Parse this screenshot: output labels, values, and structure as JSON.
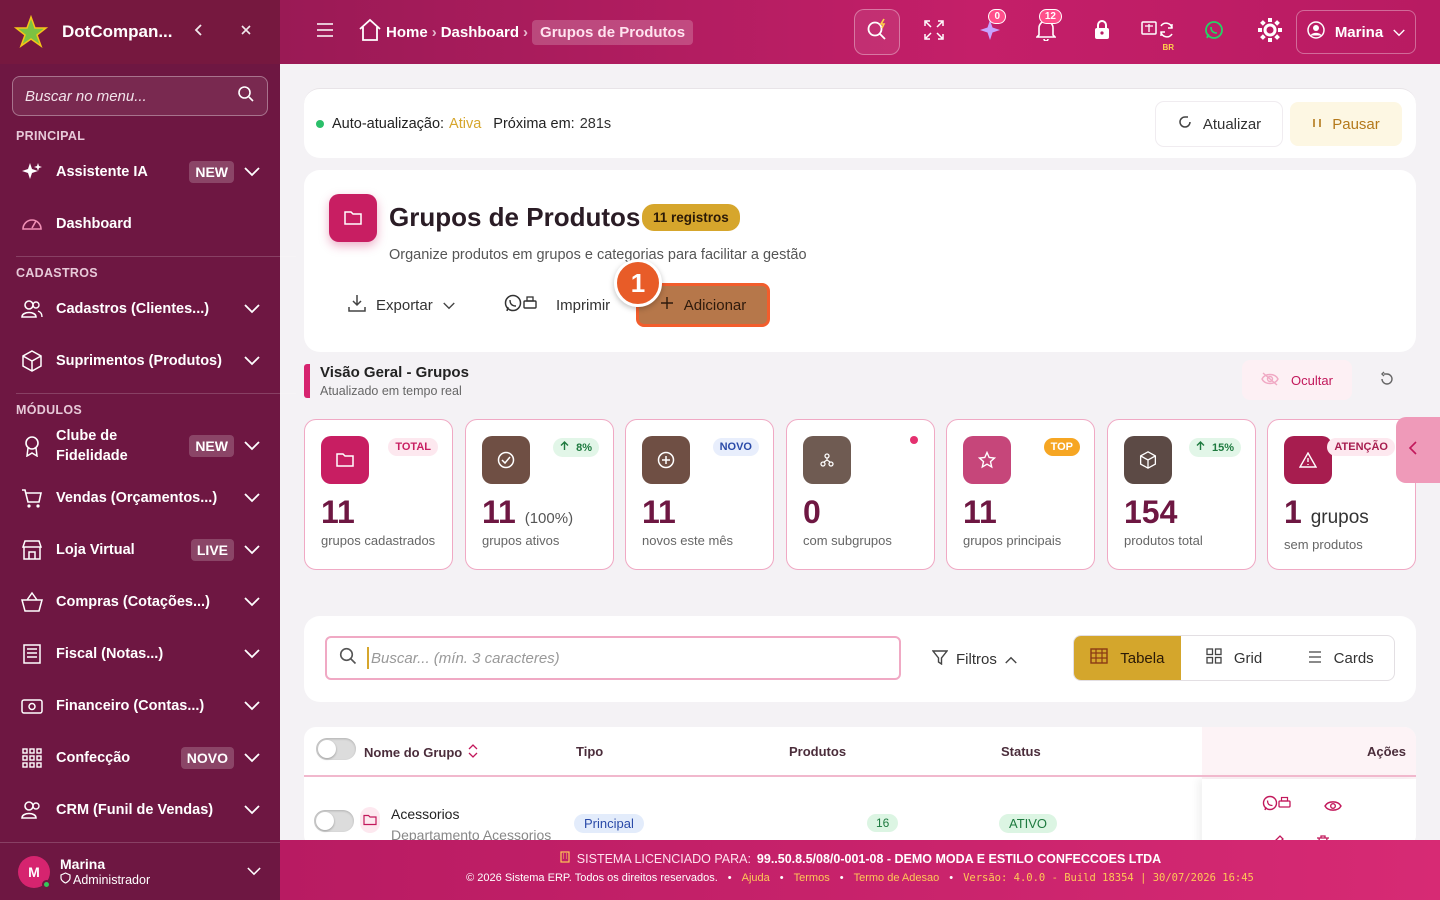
{
  "sidebar": {
    "brand": "DotCompan...",
    "search_placeholder": "Buscar no menu...",
    "sections": {
      "principal": "PRINCIPAL",
      "cadastros": "CADASTROS",
      "modulos": "MÓDULOS"
    },
    "items": [
      {
        "label": "Assistente IA",
        "badge": "NEW"
      },
      {
        "label": "Dashboard"
      },
      {
        "label": "Cadastros (Clientes...)"
      },
      {
        "label": "Suprimentos (Produtos)"
      },
      {
        "label": "Clube de Fidelidade",
        "badge": "NEW"
      },
      {
        "label": "Vendas (Orçamentos...)"
      },
      {
        "label": "Loja Virtual",
        "badge": "LIVE"
      },
      {
        "label": "Compras (Cotações...)"
      },
      {
        "label": "Fiscal (Notas...)"
      },
      {
        "label": "Financeiro (Contas...)"
      },
      {
        "label": "Confecção",
        "badge": "NOVO"
      },
      {
        "label": "CRM (Funil de Vendas)"
      }
    ],
    "user": {
      "initial": "M",
      "name": "Marina",
      "role": "Administrador"
    }
  },
  "topbar": {
    "breadcrumb": {
      "home": "Home",
      "dashboard": "Dashboard",
      "current": "Grupos de Produtos"
    },
    "ai_badge": "0",
    "notifications_badge": "12",
    "lang_label": "BR",
    "user_name": "Marina"
  },
  "auto_refresh": {
    "label": "Auto-atualização:",
    "state": "Ativa",
    "next_label": "Próxima em:",
    "next_value": "281s",
    "refresh_button": "Atualizar",
    "pause_button": "Pausar"
  },
  "header": {
    "title": "Grupos de Produtos",
    "count_badge": "11 registros",
    "subtitle": "Organize produtos em grupos e categorias para facilitar a gestão",
    "export_button": "Exportar",
    "print_button": "Imprimir",
    "add_button": "Adicionar",
    "step_marker": "1"
  },
  "overview": {
    "title": "Visão Geral - Grupos",
    "subtitle": "Atualizado em tempo real",
    "hide_button": "Ocultar",
    "cards": [
      {
        "value": "11",
        "label": "grupos cadastrados",
        "tag": "TOTAL"
      },
      {
        "value": "11",
        "extra": "(100%)",
        "label": "grupos ativos",
        "tag": "8%"
      },
      {
        "value": "11",
        "label": "novos este mês",
        "tag": "NOVO"
      },
      {
        "value": "0",
        "label": "com subgrupos"
      },
      {
        "value": "11",
        "label": "grupos principais",
        "tag": "TOP"
      },
      {
        "value": "154",
        "label": "produtos total",
        "tag": "15%"
      },
      {
        "value": "1",
        "unit": "grupos",
        "label": "sem produtos",
        "tag": "ATENÇÃO"
      }
    ]
  },
  "search": {
    "placeholder": "Buscar... (mín. 3 caracteres)",
    "filters_button": "Filtros",
    "views": [
      "Tabela",
      "Grid",
      "Cards"
    ]
  },
  "table": {
    "columns": [
      "Nome do Grupo",
      "Tipo",
      "Produtos",
      "Status",
      "Ações"
    ],
    "rows": [
      {
        "name": "Acessorios",
        "description": "Departamento Acessorios",
        "type": "Principal",
        "products": "16",
        "status": "ATIVO"
      }
    ]
  },
  "footer": {
    "license": "SISTEMA LICENCIADO PARA:",
    "license_id": "99..50.8.5/08/0-001-08 - DEMO MODA E ESTILO CONFECCOES LTDA",
    "copyright": "© 2026 Sistema ERP. Todos os direitos reservados.",
    "links": [
      "Ajuda",
      "Termos",
      "Termo de Adesao"
    ],
    "version": "Versão: 4.0.0 - Build 18354 | 30/07/2026 16:45"
  }
}
